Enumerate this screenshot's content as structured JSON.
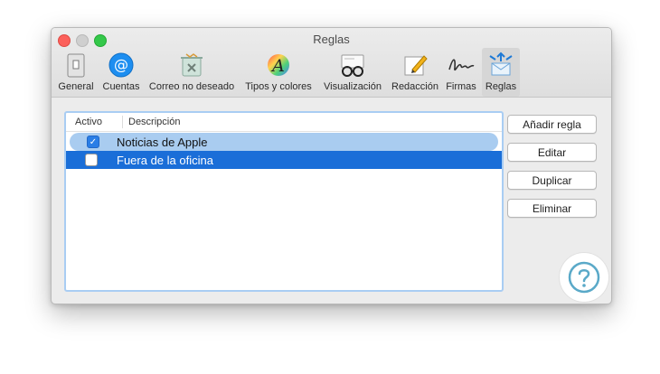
{
  "window": {
    "title": "Reglas"
  },
  "toolbar": {
    "items": [
      {
        "label": "General",
        "icon": "general-icon"
      },
      {
        "label": "Cuentas",
        "icon": "at-icon"
      },
      {
        "label": "Correo no deseado",
        "icon": "junk-mail-icon"
      },
      {
        "label": "Tipos y colores",
        "icon": "fonts-colors-icon"
      },
      {
        "label": "Visualización",
        "icon": "glasses-icon"
      },
      {
        "label": "Redacción",
        "icon": "pencil-icon"
      },
      {
        "label": "Firmas",
        "icon": "signature-icon"
      },
      {
        "label": "Reglas",
        "icon": "rules-icon",
        "selected": true
      }
    ]
  },
  "rules_table": {
    "columns": [
      "Activo",
      "Descripción"
    ],
    "rows": [
      {
        "active": true,
        "description": "Noticias de Apple"
      },
      {
        "active": false,
        "description": "Fuera de la oficina"
      }
    ]
  },
  "buttons": {
    "add": "Añadir regla",
    "edit": "Editar",
    "duplicate": "Duplicar",
    "delete": "Eliminar"
  },
  "colors": {
    "accent": "#1a6ed8",
    "row_highlight": "#a9ccf0",
    "watermark": "#5aa9c8"
  }
}
